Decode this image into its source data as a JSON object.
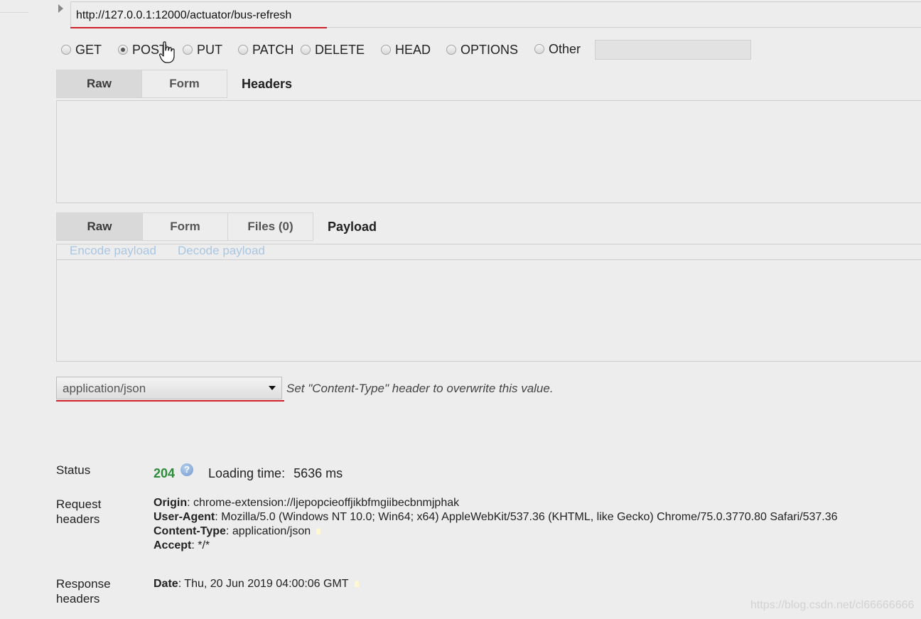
{
  "request": {
    "url": "http://127.0.0.1:12000/actuator/bus-refresh",
    "methods": [
      {
        "label": "GET",
        "checked": false
      },
      {
        "label": "POST",
        "checked": true
      },
      {
        "label": "PUT",
        "checked": false
      },
      {
        "label": "PATCH",
        "checked": false
      },
      {
        "label": "DELETE",
        "checked": false
      },
      {
        "label": "HEAD",
        "checked": false
      },
      {
        "label": "OPTIONS",
        "checked": false
      },
      {
        "label": "Other",
        "checked": false
      }
    ],
    "other_value": ""
  },
  "headers_section": {
    "tabs": [
      "Raw",
      "Form"
    ],
    "active_tab": "Raw",
    "title": "Headers",
    "value": ""
  },
  "payload_section": {
    "tabs": [
      "Raw",
      "Form",
      "Files (0)"
    ],
    "active_tab": "Raw",
    "title": "Payload",
    "encode_link": "Encode payload",
    "decode_link": "Decode payload",
    "value": ""
  },
  "content_type": {
    "selected": "application/json",
    "hint": "Set \"Content-Type\" header to overwrite this value."
  },
  "response": {
    "status_label": "Status",
    "status_code": "204",
    "info_icon_glyph": "?",
    "loading_label": "Loading time:",
    "loading_value": "5636 ms",
    "request_headers_label_1": "Request",
    "request_headers_label_2": "headers",
    "request_headers": [
      {
        "name": "Origin",
        "value": ": chrome-extension://ljepopcieoffjikbfmgiibecbnmjphak"
      },
      {
        "name": "User-Agent",
        "value": ": Mozilla/5.0 (Windows NT 10.0; Win64; x64) AppleWebKit/537.36 (KHTML, like Gecko) Chrome/75.0.3770.80 Safari/537.36"
      },
      {
        "name": "Content-Type",
        "value": ": application/json"
      },
      {
        "name": "Accept",
        "value": ": */*"
      }
    ],
    "response_headers_label_1": "Response",
    "response_headers_label_2": "headers",
    "response_headers": [
      {
        "name": "Date",
        "value": ": Thu, 20 Jun 2019 04:00:06 GMT"
      }
    ]
  },
  "watermark": "https://blog.csdn.net/cl66666666",
  "colors": {
    "status_ok": "#2e8b3a",
    "underline": "#d0202a",
    "link": "#a9c6e2"
  }
}
